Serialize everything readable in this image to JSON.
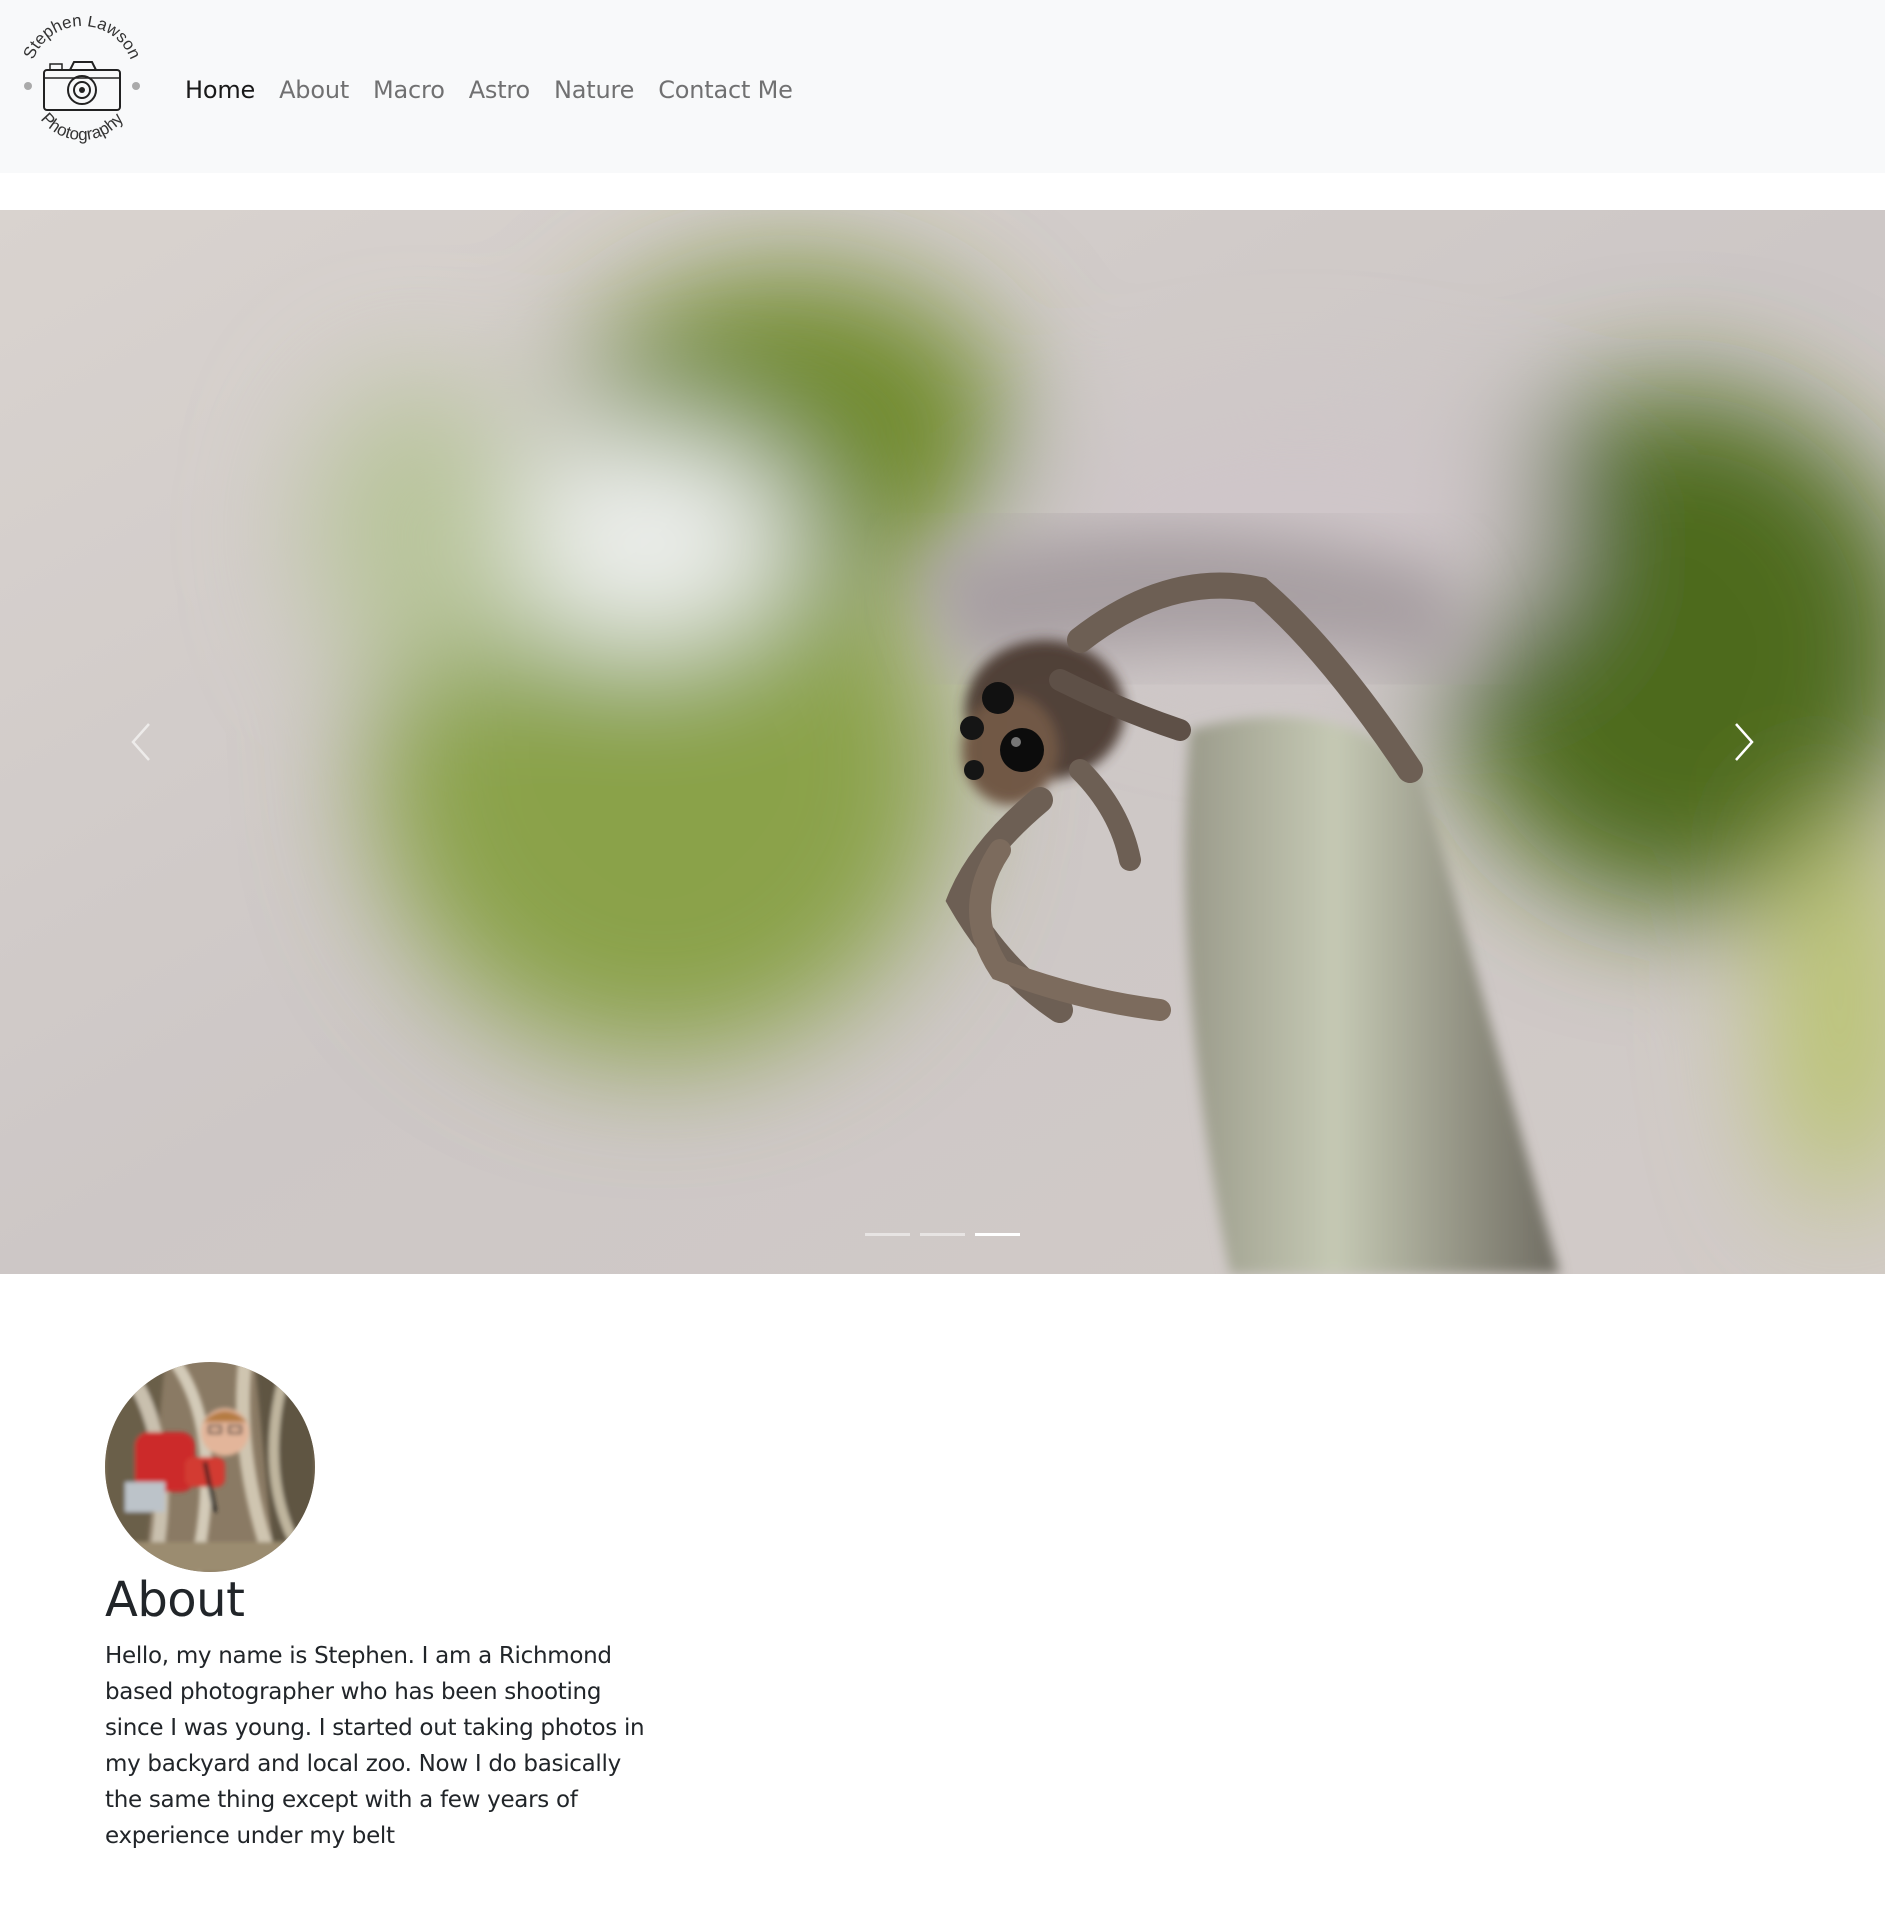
{
  "brand": {
    "logo_top_text": "Stephen Lawson",
    "logo_bottom_text": "Photography"
  },
  "nav": {
    "items": [
      {
        "label": "Home",
        "active": true
      },
      {
        "label": "About",
        "active": false
      },
      {
        "label": "Macro",
        "active": false
      },
      {
        "label": "Astro",
        "active": false
      },
      {
        "label": "Nature",
        "active": false
      },
      {
        "label": "Contact Me",
        "active": false
      }
    ]
  },
  "carousel": {
    "slide_count": 3,
    "active_index": 2,
    "prev_icon": "chevron-left-icon",
    "next_icon": "chevron-right-icon"
  },
  "about": {
    "title": "About",
    "text": "Hello, my name is Stephen. I am a Richmond based photographer who has been shooting since I was young. I started out taking photos in my backyard and local zoo. Now I do basically the same thing except with a few years of experience under my belt"
  },
  "colors": {
    "navbar_bg": "#f8f9fa",
    "nav_active": "#1a1a1a",
    "nav_inactive": "#737373"
  }
}
